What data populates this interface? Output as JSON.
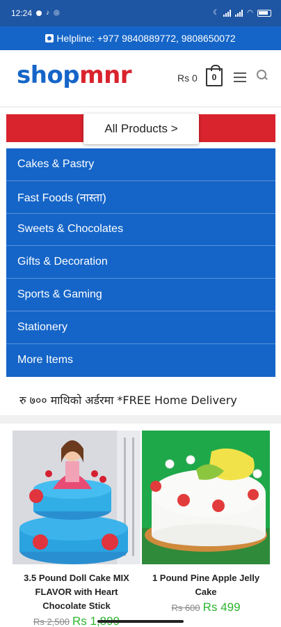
{
  "status_bar": {
    "time": "12:24"
  },
  "helpline": {
    "text": "Helpline: +977 9840889772, 9808650072"
  },
  "header": {
    "logo_part1": "shop",
    "logo_part2": "mnr",
    "cart_total": "Rs 0",
    "cart_count": "0"
  },
  "all_products": {
    "label": "All Products >"
  },
  "categories": [
    {
      "label": "Cakes & Pastry"
    },
    {
      "label": "Fast Foods (नास्ता)"
    },
    {
      "label": "Sweets & Chocolates"
    },
    {
      "label": "Gifts & Decoration"
    },
    {
      "label": "Sports & Gaming"
    },
    {
      "label": "Stationery"
    },
    {
      "label": "More Items"
    }
  ],
  "promo": {
    "text": "रु ७०० माथिको अर्डरमा *FREE Home Delivery"
  },
  "products": [
    {
      "name": "3.5 Pound Doll Cake MIX FLAVOR with Heart Chocolate Stick",
      "old_price": "Rs 2,500",
      "new_price": "Rs 1,899"
    },
    {
      "name": "1 Pound Pine Apple Jelly Cake",
      "old_price": "Rs 600",
      "new_price": "Rs 499"
    }
  ],
  "colors": {
    "brand_blue": "#1565c8",
    "brand_red": "#d9232d",
    "price_green": "#2db52d"
  }
}
